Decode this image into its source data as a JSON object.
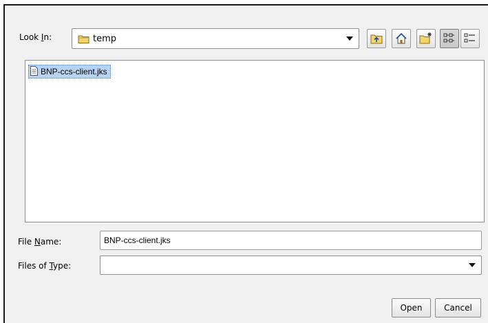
{
  "look_in": {
    "label_pre": "Look ",
    "label_mnemonic": "I",
    "label_post": "n:",
    "value": "temp",
    "value_icon": "folder-icon"
  },
  "toolbar": {
    "buttons": [
      {
        "name": "up-one-level-button",
        "icon": "folder-up-icon",
        "pressed": false
      },
      {
        "name": "home-button",
        "icon": "home-icon",
        "pressed": false
      },
      {
        "name": "new-folder-button",
        "icon": "new-folder-icon",
        "pressed": false
      },
      {
        "name": "list-view-button",
        "icon": "list-view-icon",
        "pressed": true
      },
      {
        "name": "details-view-button",
        "icon": "details-view-icon",
        "pressed": false
      }
    ]
  },
  "files": [
    {
      "name": "BNP-ccs-client.jks",
      "icon": "file-icon",
      "selected": true
    }
  ],
  "file_name": {
    "label_pre": "File ",
    "label_mnemonic": "N",
    "label_post": "ame:",
    "value": "BNP-ccs-client.jks"
  },
  "file_type": {
    "label_pre": "Files of ",
    "label_mnemonic": "T",
    "label_post": "ype:",
    "value": ""
  },
  "buttons": {
    "open": "Open",
    "cancel": "Cancel"
  },
  "colors": {
    "dialog_bg": "#f0f0f0",
    "selection_bg": "#b8d3f2",
    "folder_yellow": "#f2d46a"
  }
}
